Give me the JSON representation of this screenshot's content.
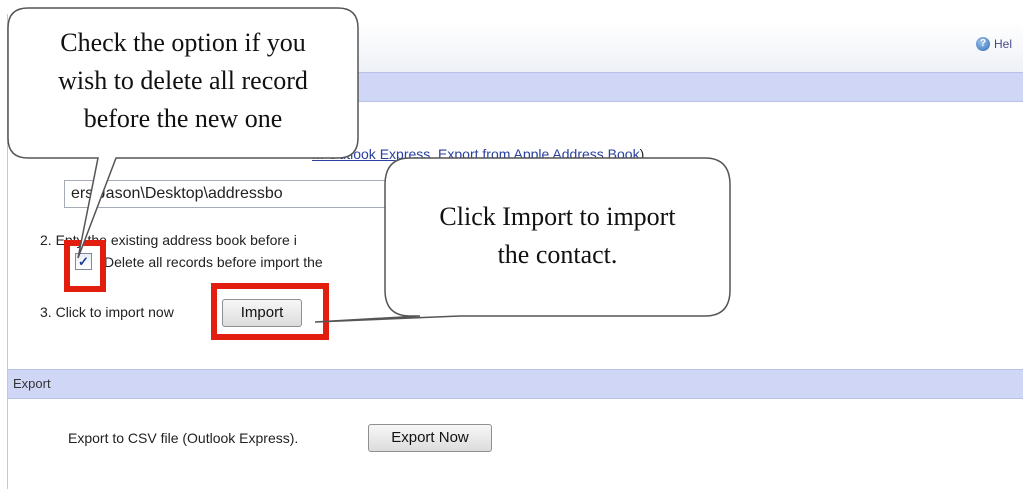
{
  "header": {
    "help_label": "Hel"
  },
  "import": {
    "step1_partial": "m Outlook Express, Export from Apple Address Book",
    "step1_close": ")",
    "file_path": "ers\\Jason\\Desktop\\addressbo",
    "step2_number": "2.",
    "step2_text_partial": "E",
    "step2_text_rest": "pty the existing address book before i",
    "checkbox_checked": "✓",
    "checkbox_label": "Delete all records before import the",
    "step3_number": "3.",
    "step3_text": "Click to import now",
    "import_button": "Import"
  },
  "export": {
    "section_title": "Export",
    "export_label": "Export to CSV file (Outlook Express).",
    "export_button": "Export Now"
  },
  "callouts": {
    "delete_hint": [
      "Check the option if you",
      "wish to delete all record",
      "before the new one"
    ],
    "import_hint": [
      "Click Import to import",
      "the contact."
    ]
  },
  "colors": {
    "highlight": "#e21f0f",
    "section_header": "#cfd6f6",
    "link": "#2a3f9e"
  }
}
